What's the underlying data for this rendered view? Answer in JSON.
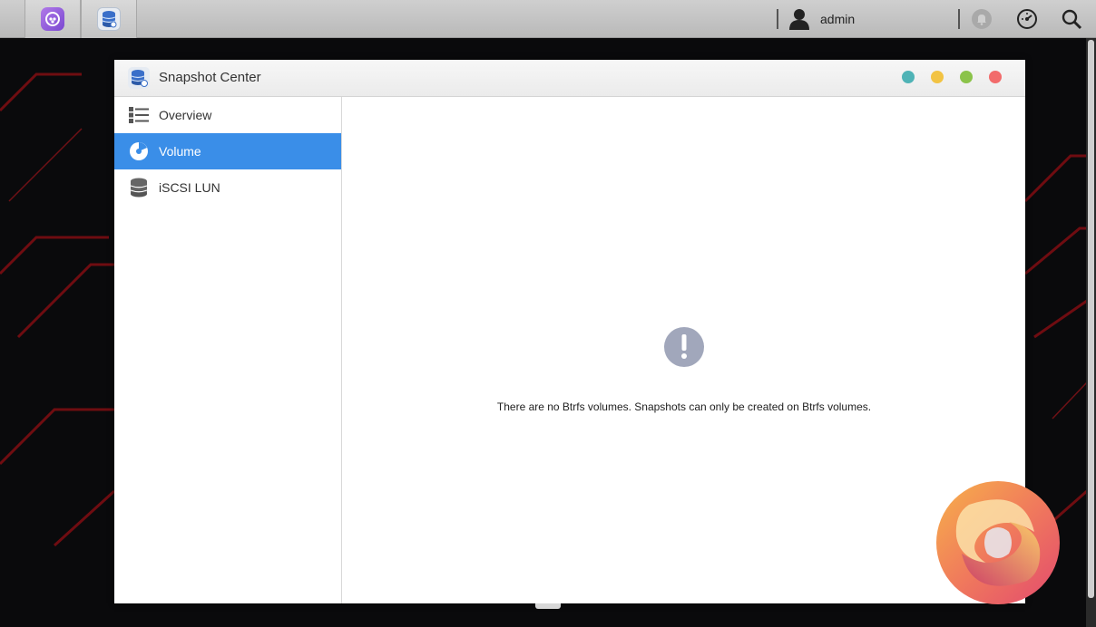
{
  "taskbar": {
    "apps": [
      {
        "icon": "purple-app-icon"
      },
      {
        "icon": "snapshot-center-icon"
      }
    ],
    "user": {
      "name": "admin"
    },
    "icons": [
      "notification-bell-icon",
      "dashboard-gauge-icon",
      "search-icon"
    ]
  },
  "window": {
    "title": "Snapshot Center",
    "controls": [
      "minimize-teal",
      "restore-yellow",
      "maximize-green",
      "close-red"
    ]
  },
  "sidebar": {
    "items": [
      {
        "label": "Overview",
        "icon": "overview-list-icon",
        "active": false
      },
      {
        "label": "Volume",
        "icon": "volume-disc-icon",
        "active": true
      },
      {
        "label": "iSCSI LUN",
        "icon": "database-stack-icon",
        "active": false
      }
    ]
  },
  "content": {
    "empty_message": "There are no Btrfs volumes. Snapshots can only be created on Btrfs volumes.",
    "empty_icon": "exclamation-icon"
  },
  "colors": {
    "active_nav": "#3a8ee8",
    "empty_icon_bg": "#a1a7bb",
    "win_teal": "#4fb3b6",
    "win_yellow": "#f2c343",
    "win_green": "#8bc34a",
    "win_red": "#f26b6b"
  }
}
